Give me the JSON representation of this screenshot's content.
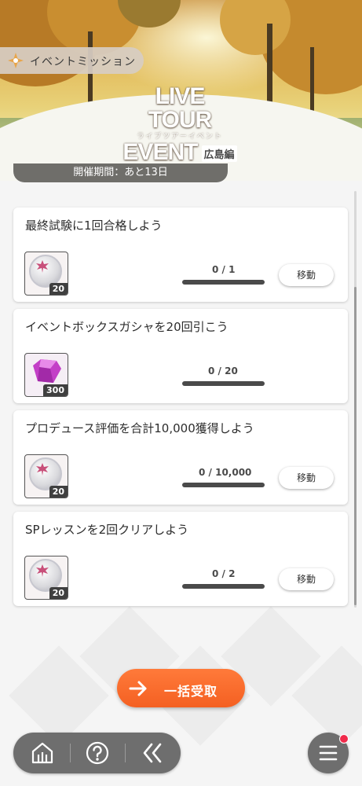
{
  "header": {
    "mission_tab_label": "イベントミッション",
    "logo_line1": "LIVE TOUR",
    "logo_sub": "ライブツアーイベント",
    "logo_line2": "EVENT",
    "logo_location": "広島編",
    "period_text": "開催期間：あと13日"
  },
  "missions": [
    {
      "title": "最終試験に1回合格しよう",
      "reward_icon": "medal-icon",
      "reward_qty": "20",
      "progress_text": "0 / 1",
      "progress": 0,
      "has_move": true,
      "move_label": "移動"
    },
    {
      "title": "イベントボックスガシャを20回引こう",
      "reward_icon": "gem-icon",
      "reward_qty": "300",
      "progress_text": "0 / 20",
      "progress": 0,
      "has_move": false,
      "move_label": ""
    },
    {
      "title": "プロデュース評価を合計10,000獲得しよう",
      "reward_icon": "medal-icon",
      "reward_qty": "20",
      "progress_text": "0 / 10,000",
      "progress": 0,
      "has_move": true,
      "move_label": "移動"
    },
    {
      "title": "SPレッスンを2回クリアしよう",
      "reward_icon": "medal-icon",
      "reward_qty": "20",
      "progress_text": "0 / 2",
      "progress": 0,
      "has_move": true,
      "move_label": "移動"
    }
  ],
  "footer": {
    "claim_all_label": "一括受取",
    "nav_icons": [
      "home-icon",
      "help-icon",
      "back-icon"
    ],
    "menu_icon": "menu-icon",
    "menu_has_notification": true
  },
  "colors": {
    "accent": "#f46022",
    "dark": "#6e6e6e",
    "notify": "#f02a4a"
  }
}
